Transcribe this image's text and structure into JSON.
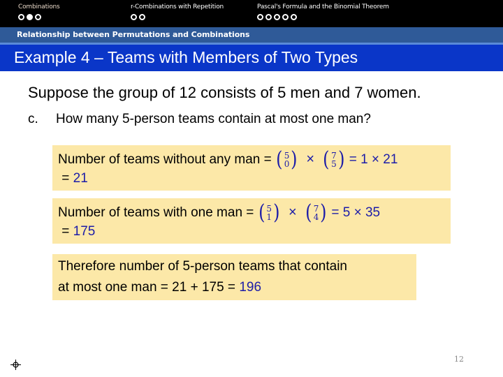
{
  "nav": {
    "sections": [
      {
        "title": "Combinations",
        "dots": [
          false,
          true,
          false
        ],
        "active": true
      },
      {
        "title": "r-Combinations with Repetition",
        "dots": [
          false,
          false
        ],
        "active": false
      },
      {
        "title": "Pascal's Formula and the Binomial Theorem",
        "dots": [
          false,
          false,
          false,
          false,
          false
        ],
        "active": false
      }
    ]
  },
  "subsection": "Relationship between Permutations and Combinations",
  "title": "Example 4 – Teams with Members of Two Types",
  "intro": "Suppose the group of 12 consists of 5 men and 7 women.",
  "question": {
    "label": "c.",
    "text": "How many 5-person teams contain at most one man?"
  },
  "boxes": {
    "no_man": {
      "text": "Number of teams without any man = ",
      "binom1": {
        "n": "5",
        "k": "0"
      },
      "times": "×",
      "binom2": {
        "n": "7",
        "k": "5"
      },
      "product": "= 1 × 21",
      "result_eq": "= ",
      "result": "21"
    },
    "one_man": {
      "text": "Number of teams with one man = ",
      "binom1": {
        "n": "5",
        "k": "1"
      },
      "times": "×",
      "binom2": {
        "n": "7",
        "k": "4"
      },
      "product": "= 5 × 35",
      "result_eq": "= ",
      "result": "175"
    },
    "conclusion": {
      "line1": "Therefore number of 5-person teams that contain",
      "line2": "at most one man =  21 + 175 = ",
      "result": "196"
    }
  },
  "footer": {
    "page_number": "12",
    "icon": "target-icon"
  },
  "colors": {
    "title_bar": "#0a36c8",
    "subsection_bar": "#2f5a98",
    "box_fill": "#fce8a8",
    "math_blue": "#1c1ca8"
  }
}
